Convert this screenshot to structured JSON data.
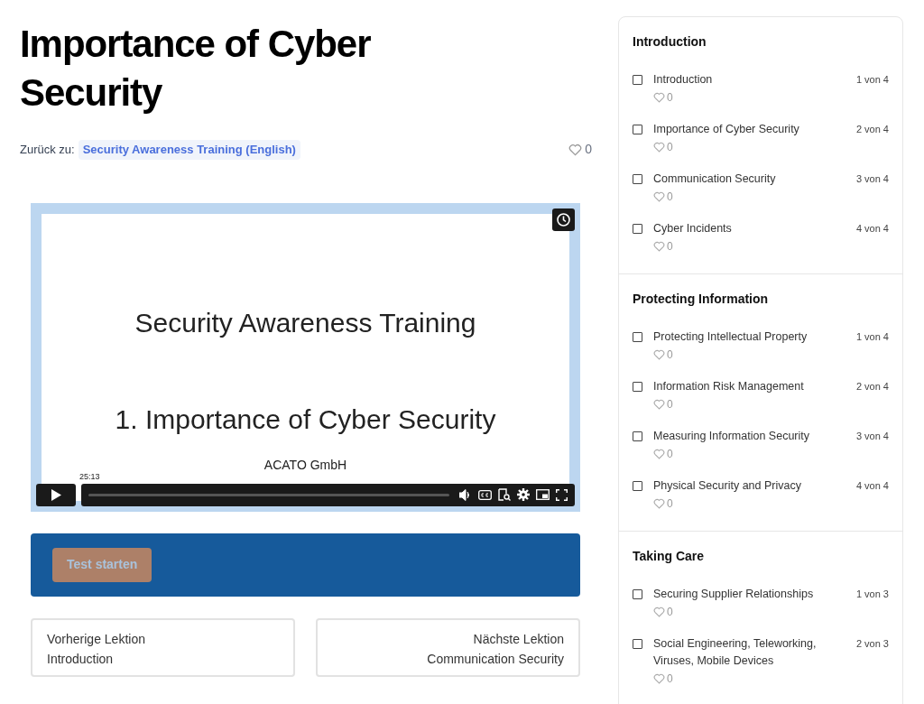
{
  "title": "Importance of Cyber Security",
  "breadcrumb": {
    "label": "Zurück zu:",
    "link": "Security Awareness Training (English)"
  },
  "likes": "0",
  "video": {
    "slide_title": "Security Awareness Training",
    "slide_subtitle": "1. Importance of Cyber Security",
    "slide_footer": "ACATO GmbH",
    "timestamp": "25:13"
  },
  "test_button": {
    "label": "Test starten",
    "disabled": true
  },
  "navigation": [
    {
      "kind": "previous",
      "caption": "Vorherige Lektion",
      "lesson": "Introduction"
    },
    {
      "kind": "next",
      "caption": "Nächste Lektion",
      "lesson": "Communication Security"
    }
  ],
  "sidebar": {
    "sections": [
      {
        "title": "Introduction",
        "lessons": [
          {
            "title": "Introduction",
            "likes": "0",
            "position": "1 von 4",
            "checked": false
          },
          {
            "title": "Importance of Cyber Security",
            "likes": "0",
            "position": "2 von 4",
            "checked": false
          },
          {
            "title": "Communication Security",
            "likes": "0",
            "position": "3 von 4",
            "checked": false
          },
          {
            "title": "Cyber Incidents",
            "likes": "0",
            "position": "4 von 4",
            "checked": false
          }
        ]
      },
      {
        "title": "Protecting Information",
        "lessons": [
          {
            "title": "Protecting Intellectual Property",
            "likes": "0",
            "position": "1 von 4",
            "checked": false
          },
          {
            "title": "Information Risk Management",
            "likes": "0",
            "position": "2 von 4",
            "checked": false
          },
          {
            "title": "Measuring Information Security",
            "likes": "0",
            "position": "3 von 4",
            "checked": false
          },
          {
            "title": "Physical Security and Privacy",
            "likes": "0",
            "position": "4 von 4",
            "checked": false
          }
        ]
      },
      {
        "title": "Taking Care",
        "lessons": [
          {
            "title": "Securing Supplier Relationships",
            "likes": "0",
            "position": "1 von 3",
            "checked": false
          },
          {
            "title": "Social Engineering, Teleworking, Viruses, Mobile Devices",
            "likes": "0",
            "position": "2 von 3",
            "checked": false
          }
        ]
      }
    ]
  }
}
